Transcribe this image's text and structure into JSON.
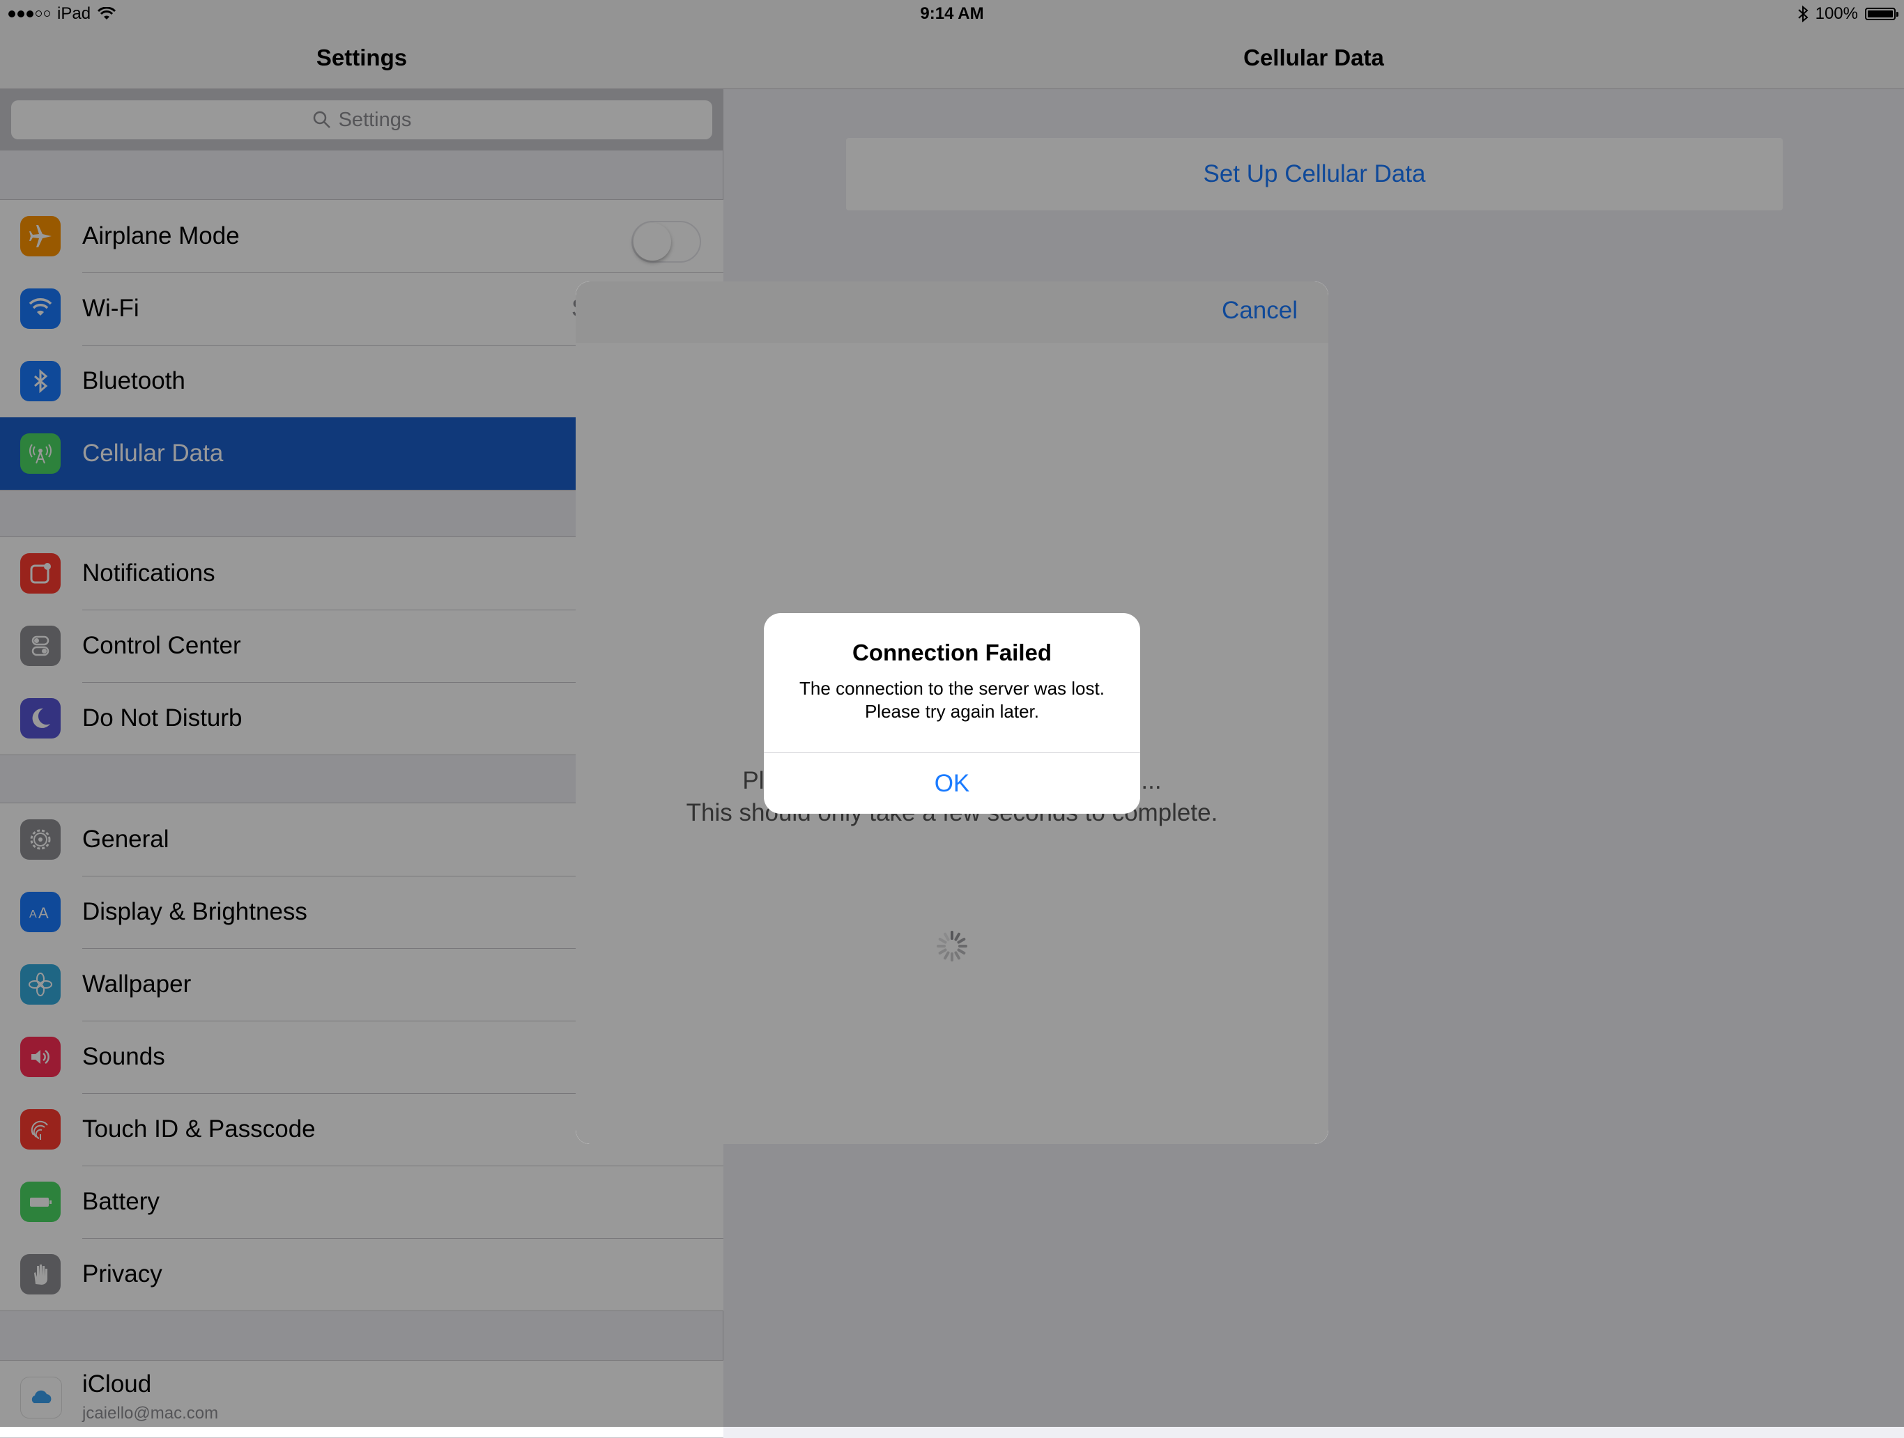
{
  "status_bar": {
    "carrier": "iPad",
    "time": "9:14 AM",
    "battery": "100%",
    "signal_bars": 3
  },
  "master": {
    "title": "Settings",
    "search_placeholder": "Settings",
    "groups": [
      [
        {
          "label": "Airplane Mode",
          "icon": "airplane-icon",
          "color": "#ff9500",
          "toggle": false
        },
        {
          "label": "Wi-Fi",
          "icon": "wifi-icon",
          "color": "#1a7bff",
          "trailing_fragment": "S"
        },
        {
          "label": "Bluetooth",
          "icon": "bluetooth-icon",
          "color": "#1a7bff"
        },
        {
          "label": "Cellular Data",
          "icon": "cellular-icon",
          "color": "#4cd964",
          "selected": true
        }
      ],
      [
        {
          "label": "Notifications",
          "icon": "notifications-icon",
          "color": "#ff3b30"
        },
        {
          "label": "Control Center",
          "icon": "control-center-icon",
          "color": "#8e8e93"
        },
        {
          "label": "Do Not Disturb",
          "icon": "moon-icon",
          "color": "#5856d6"
        }
      ],
      [
        {
          "label": "General",
          "icon": "gear-icon",
          "color": "#8e8e93"
        },
        {
          "label": "Display & Brightness",
          "icon": "text-size-icon",
          "color": "#1a7bff"
        },
        {
          "label": "Wallpaper",
          "icon": "wallpaper-icon",
          "color": "#34aadc"
        },
        {
          "label": "Sounds",
          "icon": "speaker-icon",
          "color": "#ff2d55"
        },
        {
          "label": "Touch ID & Passcode",
          "icon": "fingerprint-icon",
          "color": "#ff3b30"
        },
        {
          "label": "Battery",
          "icon": "battery-icon",
          "color": "#4cd964"
        },
        {
          "label": "Privacy",
          "icon": "hand-icon",
          "color": "#8e8e93"
        }
      ]
    ],
    "account": {
      "name": "iCloud",
      "email": "jcaiello@mac.com",
      "icon": "icloud-icon"
    }
  },
  "detail": {
    "title": "Cellular Data",
    "setup_button": "Set Up Cellular Data"
  },
  "sheet": {
    "cancel": "Cancel",
    "loading_line1": "Please wait while the page is loading...",
    "loading_line2": "This should only take a few seconds to complete."
  },
  "alert": {
    "title": "Connection Failed",
    "message_line1": "The connection to the server was lost.",
    "message_line2": "Please try again later.",
    "ok": "OK"
  },
  "colors": {
    "tint": "#1a7bff",
    "selection": "#1c5fcc",
    "dim_overlay": "rgba(0,0,0,0.4)"
  }
}
